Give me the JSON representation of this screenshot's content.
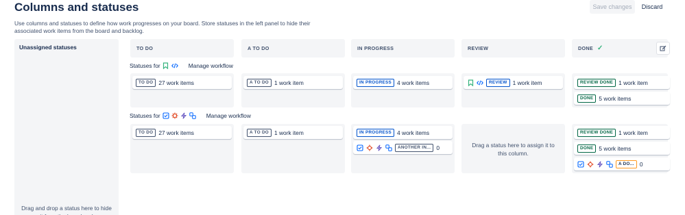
{
  "header": {
    "title": "Columns and statuses",
    "save_label": "Save changes",
    "discard_label": "Discard",
    "description": "Use columns and statuses to define how work progresses on your board. Store statuses in the left panel to hide their associated work items from the board and backlog."
  },
  "unassigned": {
    "title": "Unassigned statuses",
    "hint": "Drag and drop a status here to hide it from the board and"
  },
  "columns": [
    {
      "label": "TO DO"
    },
    {
      "label": "A TO DO"
    },
    {
      "label": "IN PROGRESS"
    },
    {
      "label": "REVIEW"
    },
    {
      "label": "DONE"
    }
  ],
  "workflow1": {
    "prefix": "Statuses for",
    "manage": "Manage workflow",
    "icons": [
      "bookmark-icon",
      "code-icon"
    ]
  },
  "workflow2": {
    "prefix": "Statuses for",
    "manage": "Manage workflow",
    "icons": [
      "checkbox-icon",
      "bug-icon",
      "lightning-icon",
      "subtask-icon"
    ]
  },
  "rows": {
    "w1": {
      "todo": {
        "status": "TO DO",
        "count": "27 work items"
      },
      "atodo": {
        "status": "A TO DO",
        "count": "1 work item"
      },
      "inprogress": {
        "status": "IN PROGRESS",
        "count": "4 work items"
      },
      "review": {
        "status": "REVIEW",
        "count": "1 work item"
      },
      "done": [
        {
          "status": "REVIEW DONE",
          "count": "1 work item"
        },
        {
          "status": "DONE",
          "count": "5 work items"
        }
      ]
    },
    "w2": {
      "todo": {
        "status": "TO DO",
        "count": "27 work items"
      },
      "atodo": {
        "status": "A TO DO",
        "count": "1 work item"
      },
      "inprogress": [
        {
          "status": "IN PROGRESS",
          "count": "4 work items"
        },
        {
          "status": "ANOTHER IN...",
          "count": "0"
        }
      ],
      "review_hint": "Drag a status here to assign it to this column.",
      "done": [
        {
          "status": "REVIEW DONE",
          "count": "1 work item"
        },
        {
          "status": "DONE",
          "count": "5 work items"
        },
        {
          "status": "A DO...",
          "count": "0"
        }
      ]
    }
  },
  "colors": {
    "background": "#ffffff",
    "panel": "#f4f5f7",
    "text": "#172b4d",
    "done_green": "#006644",
    "in_progress_blue": "#0052cc",
    "todo_gray": "#42526e",
    "check_green": "#36b37e"
  }
}
